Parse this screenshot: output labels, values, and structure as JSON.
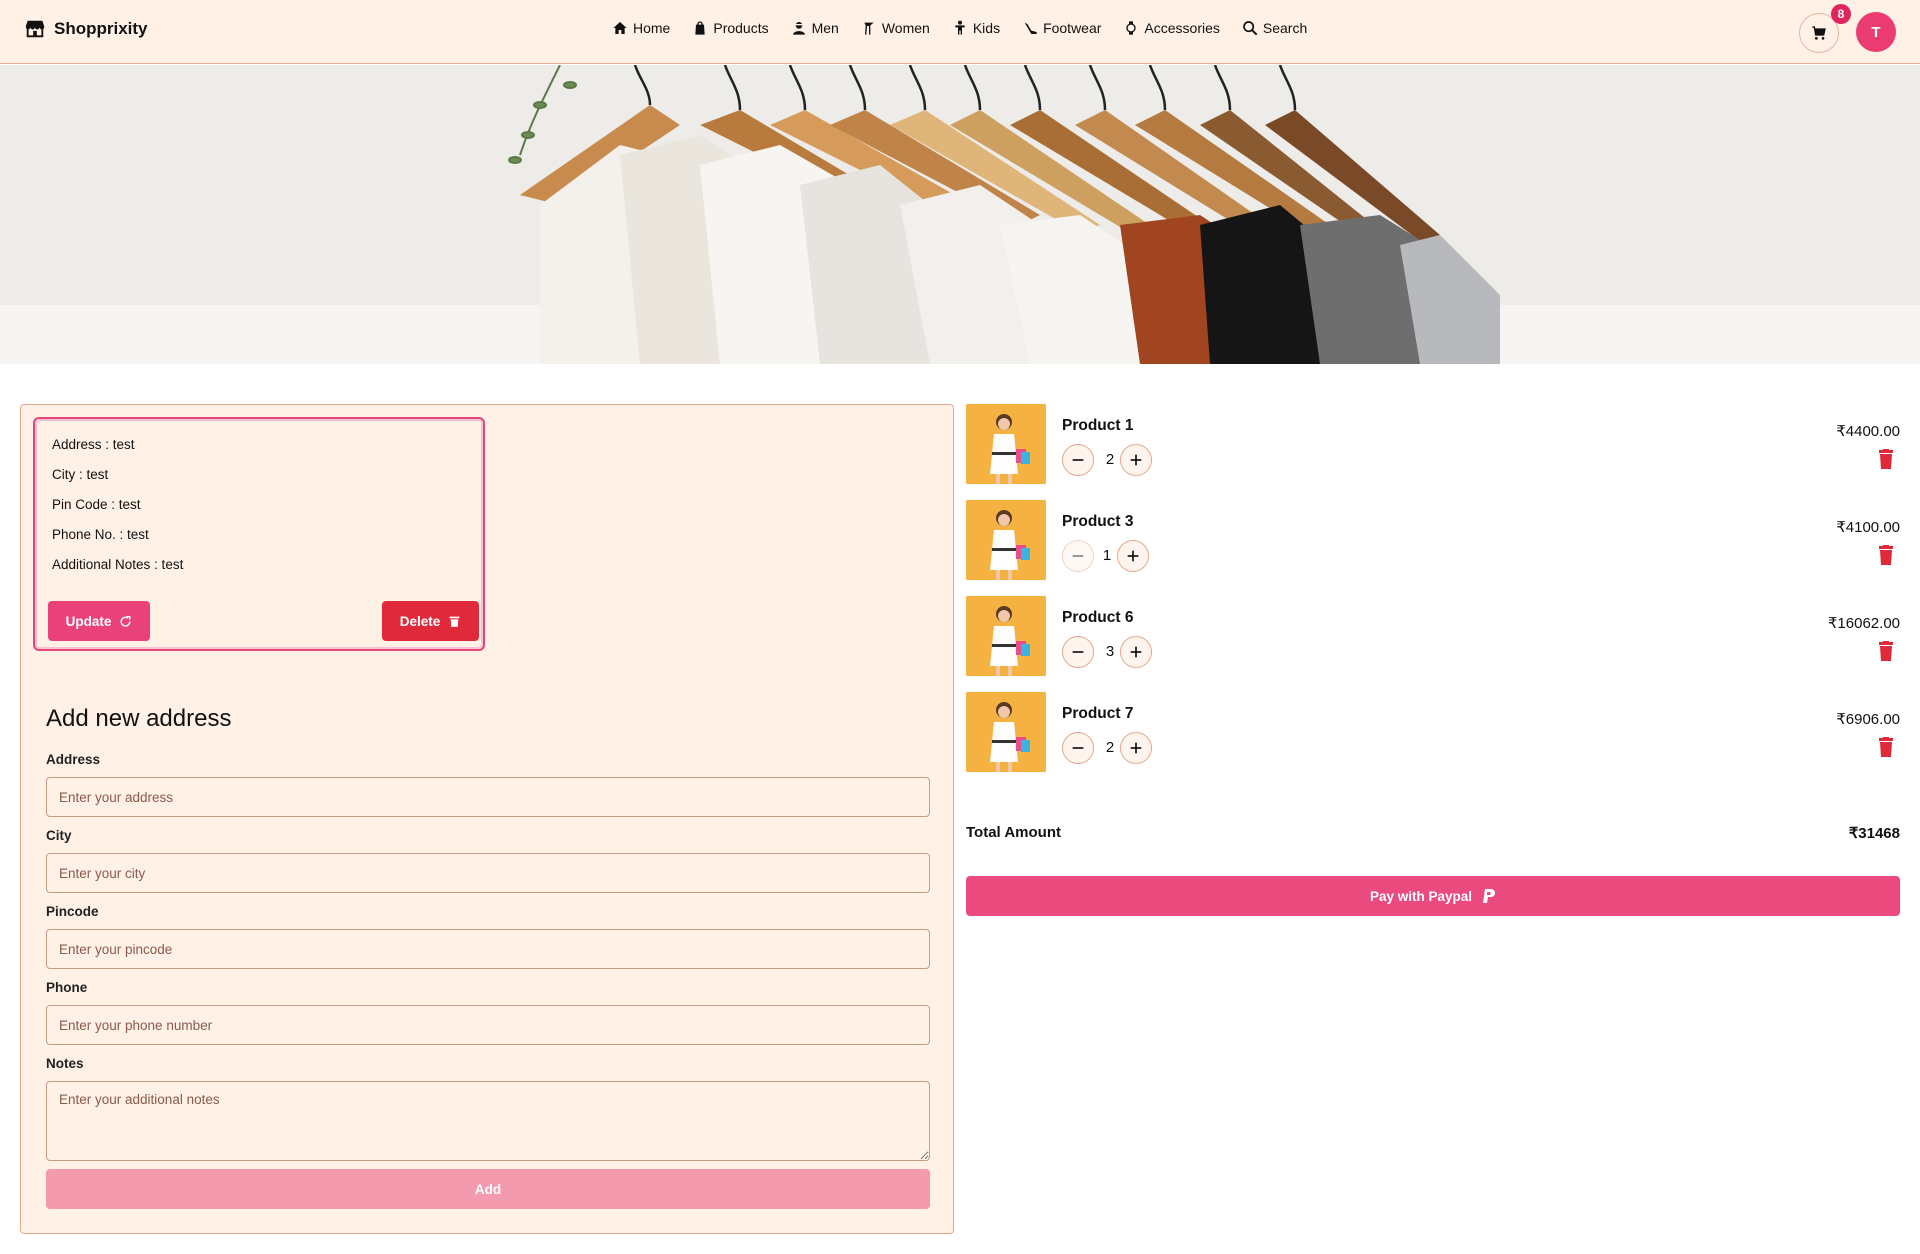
{
  "header": {
    "brand": "Shopprixity",
    "nav": [
      {
        "label": "Home",
        "icon": "home-icon"
      },
      {
        "label": "Products",
        "icon": "shopping-bag-icon"
      },
      {
        "label": "Men",
        "icon": "man-icon"
      },
      {
        "label": "Women",
        "icon": "woman-icon"
      },
      {
        "label": "Kids",
        "icon": "child-icon"
      },
      {
        "label": "Footwear",
        "icon": "shoe-icon"
      },
      {
        "label": "Accessories",
        "icon": "watch-icon"
      },
      {
        "label": "Search",
        "icon": "search-icon"
      }
    ],
    "cart_count": "8",
    "avatar_initial": "T"
  },
  "saved_address": {
    "lines": [
      "Address : test",
      "City : test",
      "Pin Code : test",
      "Phone No. : test",
      "Additional Notes : test"
    ],
    "update_label": "Update",
    "delete_label": "Delete"
  },
  "form": {
    "title": "Add new address",
    "address_label": "Address",
    "address_placeholder": "Enter your address",
    "city_label": "City",
    "city_placeholder": "Enter your city",
    "pincode_label": "Pincode",
    "pincode_placeholder": "Enter your pincode",
    "phone_label": "Phone",
    "phone_placeholder": "Enter your phone number",
    "notes_label": "Notes",
    "notes_placeholder": "Enter your additional notes",
    "add_label": "Add"
  },
  "cart": {
    "items": [
      {
        "name": "Product 1",
        "qty": "2",
        "price": "₹4400.00"
      },
      {
        "name": "Product 3",
        "qty": "1",
        "price": "₹4100.00"
      },
      {
        "name": "Product 6",
        "qty": "3",
        "price": "₹16062.00"
      },
      {
        "name": "Product 7",
        "qty": "2",
        "price": "₹6906.00"
      }
    ],
    "total_label": "Total Amount",
    "total_value": "₹31468",
    "pay_label": "Pay with Paypal"
  },
  "colors": {
    "accent": "#ea4a7e",
    "danger": "#e02a3b",
    "panel_bg": "#fff1e6",
    "product_bg": "#f5b240"
  }
}
